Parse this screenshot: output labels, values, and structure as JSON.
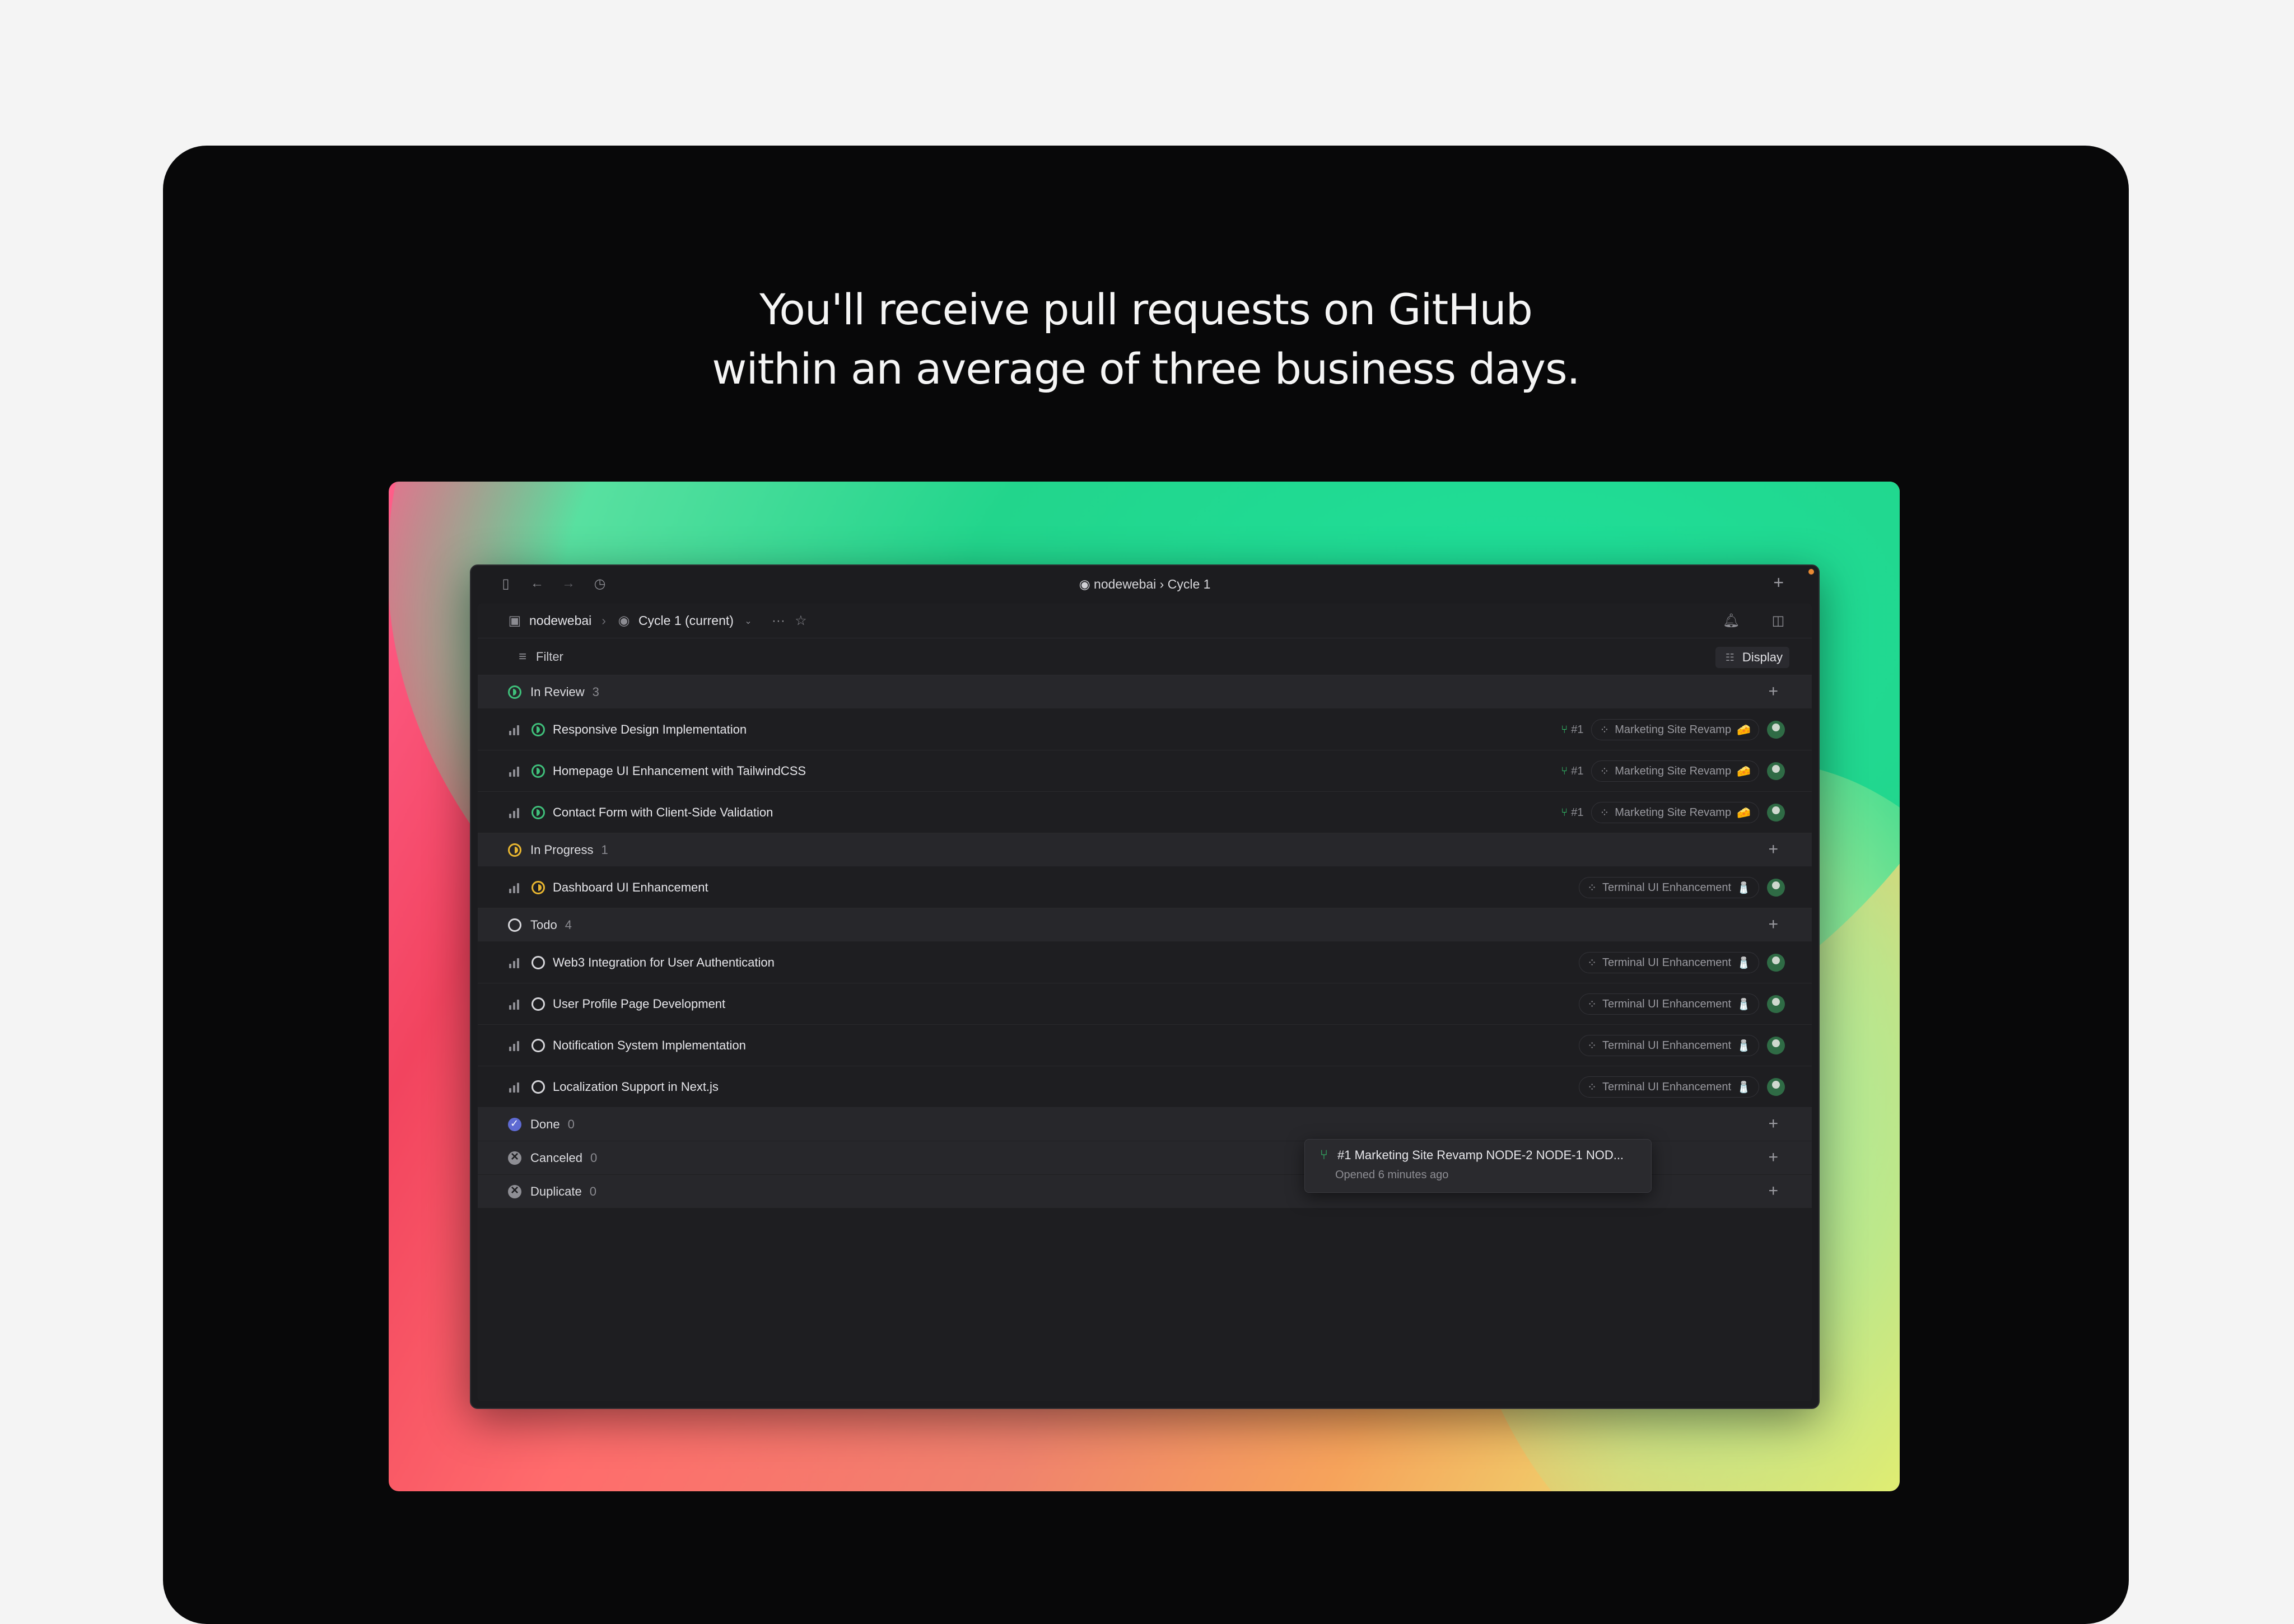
{
  "headline": {
    "line1": "You'll receive pull requests on GitHub",
    "line2": "within an average of three business days."
  },
  "window": {
    "title": "nodewebai › Cycle 1",
    "plus": "+"
  },
  "navbar": {
    "workspace": "nodewebai",
    "cycle": "Cycle 1 (current)",
    "more": "···"
  },
  "filterbar": {
    "filter_label": "Filter",
    "display_label": "Display"
  },
  "tooltip": {
    "title": "#1 Marketing Site Revamp NODE-2 NODE-1 NOD...",
    "subtitle": "Opened 6 minutes ago"
  },
  "groups": [
    {
      "name": "In Review",
      "count": "3",
      "status": "review",
      "issues": [
        {
          "title": "Responsive Design Implementation",
          "pr": "#1",
          "project": "Marketing Site Revamp",
          "project_emoji": "🧀"
        },
        {
          "title": "Homepage UI Enhancement with TailwindCSS",
          "pr": "#1",
          "project": "Marketing Site Revamp",
          "project_emoji": "🧀"
        },
        {
          "title": "Contact Form with Client-Side Validation",
          "pr": "#1",
          "project": "Marketing Site Revamp",
          "project_emoji": "🧀"
        }
      ]
    },
    {
      "name": "In Progress",
      "count": "1",
      "status": "progress",
      "issues": [
        {
          "title": "Dashboard UI Enhancement",
          "pr": "",
          "project": "Terminal UI Enhancement",
          "project_emoji": "🧂"
        }
      ]
    },
    {
      "name": "Todo",
      "count": "4",
      "status": "todo",
      "issues": [
        {
          "title": "Web3 Integration for User Authentication",
          "pr": "",
          "project": "Terminal UI Enhancement",
          "project_emoji": "🧂"
        },
        {
          "title": "User Profile Page Development",
          "pr": "",
          "project": "Terminal UI Enhancement",
          "project_emoji": "🧂"
        },
        {
          "title": "Notification System Implementation",
          "pr": "",
          "project": "Terminal UI Enhancement",
          "project_emoji": "🧂"
        },
        {
          "title": "Localization Support in Next.js",
          "pr": "",
          "project": "Terminal UI Enhancement",
          "project_emoji": "🧂"
        }
      ]
    },
    {
      "name": "Done",
      "count": "0",
      "status": "done",
      "issues": []
    },
    {
      "name": "Canceled",
      "count": "0",
      "status": "cancel",
      "issues": []
    },
    {
      "name": "Duplicate",
      "count": "0",
      "status": "cancel",
      "issues": []
    }
  ],
  "colors": {
    "review": "#3fbf7a",
    "progress": "#e7b530",
    "done": "#5e6ad2",
    "pr_green": "#33c46c"
  }
}
